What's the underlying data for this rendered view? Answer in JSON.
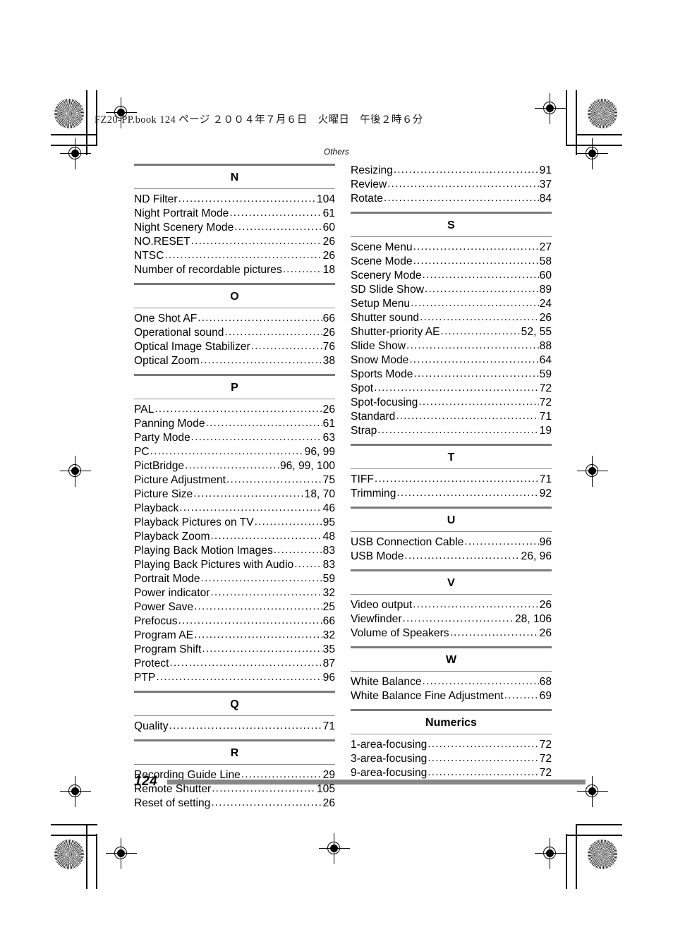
{
  "print_header": "FZ20-PP.book   124 ページ   ２００４年７月６日　火曜日　午後２時６分",
  "running_head": "Others",
  "folio": "124",
  "columns": [
    {
      "name": "left-column",
      "sections": [
        {
          "letter": "N",
          "entries": [
            {
              "term": "ND Filter",
              "pages": "104"
            },
            {
              "term": "Night Portrait Mode",
              "pages": "61"
            },
            {
              "term": "Night Scenery Mode",
              "pages": "60"
            },
            {
              "term": "NO.RESET",
              "pages": "26"
            },
            {
              "term": "NTSC",
              "pages": "26"
            },
            {
              "term": "Number of recordable pictures",
              "pages": "18"
            }
          ]
        },
        {
          "letter": "O",
          "entries": [
            {
              "term": "One Shot AF",
              "pages": "66"
            },
            {
              "term": "Operational sound",
              "pages": "26"
            },
            {
              "term": "Optical Image Stabilizer",
              "pages": "76"
            },
            {
              "term": "Optical Zoom",
              "pages": "38"
            }
          ]
        },
        {
          "letter": "P",
          "entries": [
            {
              "term": "PAL",
              "pages": "26"
            },
            {
              "term": "Panning Mode",
              "pages": "61"
            },
            {
              "term": "Party Mode",
              "pages": "63"
            },
            {
              "term": "PC",
              "pages": "96, 99"
            },
            {
              "term": "PictBridge",
              "pages": "96, 99, 100"
            },
            {
              "term": "Picture Adjustment",
              "pages": "75"
            },
            {
              "term": "Picture Size",
              "pages": "18, 70"
            },
            {
              "term": "Playback",
              "pages": "46"
            },
            {
              "term": "Playback Pictures on TV",
              "pages": "95"
            },
            {
              "term": "Playback Zoom",
              "pages": "48"
            },
            {
              "term": "Playing Back Motion Images",
              "pages": "83"
            },
            {
              "term": "Playing Back Pictures with Audio",
              "pages": "83"
            },
            {
              "term": "Portrait Mode",
              "pages": "59"
            },
            {
              "term": "Power indicator",
              "pages": "32"
            },
            {
              "term": "Power Save",
              "pages": "25"
            },
            {
              "term": "Prefocus",
              "pages": "66"
            },
            {
              "term": "Program AE",
              "pages": "32"
            },
            {
              "term": "Program Shift",
              "pages": "35"
            },
            {
              "term": "Protect",
              "pages": "87"
            },
            {
              "term": "PTP",
              "pages": "96"
            }
          ]
        },
        {
          "letter": "Q",
          "entries": [
            {
              "term": "Quality",
              "pages": "71"
            }
          ]
        },
        {
          "letter": "R",
          "entries": [
            {
              "term": "Recording Guide Line",
              "pages": "29"
            },
            {
              "term": "Remote Shutter",
              "pages": "105"
            },
            {
              "term": "Reset of setting",
              "pages": "26"
            }
          ]
        }
      ]
    },
    {
      "name": "right-column",
      "lead_entries": [
        {
          "term": "Resizing",
          "pages": "91"
        },
        {
          "term": "Review",
          "pages": "37"
        },
        {
          "term": "Rotate",
          "pages": "84"
        }
      ],
      "sections": [
        {
          "letter": "S",
          "entries": [
            {
              "term": "Scene Menu",
              "pages": "27"
            },
            {
              "term": "Scene Mode",
              "pages": "58"
            },
            {
              "term": "Scenery Mode",
              "pages": "60"
            },
            {
              "term": "SD Slide Show",
              "pages": "89"
            },
            {
              "term": "Setup Menu",
              "pages": "24"
            },
            {
              "term": "Shutter sound",
              "pages": "26"
            },
            {
              "term": "Shutter-priority AE",
              "pages": "52, 55"
            },
            {
              "term": "Slide Show",
              "pages": "88"
            },
            {
              "term": "Snow Mode",
              "pages": "64"
            },
            {
              "term": "Sports Mode",
              "pages": "59"
            },
            {
              "term": "Spot",
              "pages": "72"
            },
            {
              "term": "Spot-focusing",
              "pages": "72"
            },
            {
              "term": "Standard",
              "pages": "71"
            },
            {
              "term": "Strap",
              "pages": "19"
            }
          ]
        },
        {
          "letter": "T",
          "entries": [
            {
              "term": "TIFF",
              "pages": "71"
            },
            {
              "term": "Trimming",
              "pages": "92"
            }
          ]
        },
        {
          "letter": "U",
          "entries": [
            {
              "term": "USB Connection Cable",
              "pages": "96"
            },
            {
              "term": "USB Mode",
              "pages": "26, 96"
            }
          ]
        },
        {
          "letter": "V",
          "entries": [
            {
              "term": "Video output",
              "pages": "26"
            },
            {
              "term": "Viewfinder",
              "pages": "28, 106"
            },
            {
              "term": "Volume of Speakers",
              "pages": "26"
            }
          ]
        },
        {
          "letter": "W",
          "entries": [
            {
              "term": "White Balance",
              "pages": "68"
            },
            {
              "term": "White Balance Fine Adjustment",
              "pages": "69"
            }
          ]
        },
        {
          "letter": "Numerics",
          "entries": [
            {
              "term": "1-area-focusing",
              "pages": "72"
            },
            {
              "term": "3-area-focusing",
              "pages": "72"
            },
            {
              "term": "9-area-focusing",
              "pages": "72"
            }
          ]
        }
      ]
    }
  ]
}
